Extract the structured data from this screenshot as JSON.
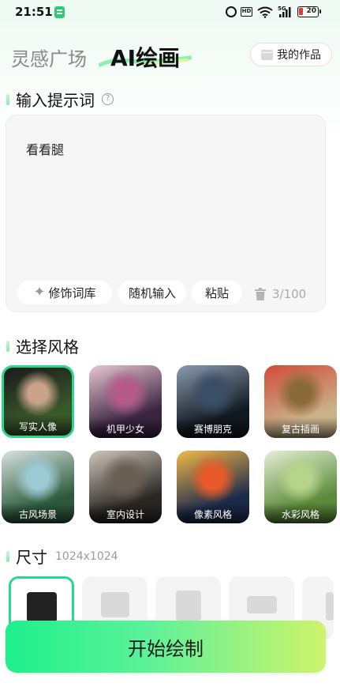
{
  "status_bar": {
    "time": "21:51",
    "hd": "HD",
    "signal": "5G",
    "battery": "20"
  },
  "header": {
    "tabs": [
      {
        "label": "灵感广场",
        "active": false
      },
      {
        "label": "AI绘画",
        "active": true
      }
    ],
    "works_button": "我的作品"
  },
  "prompt": {
    "title": "输入提示词",
    "help": "?",
    "text": "看看腿",
    "chips": [
      "修饰词库",
      "随机输入",
      "粘贴"
    ],
    "counter": "3/100"
  },
  "styles": {
    "title": "选择风格",
    "items": [
      {
        "label": "写实人像",
        "selected": true,
        "colors": [
          "#3b5a2c",
          "#c9a48a",
          "#1a1a1a"
        ]
      },
      {
        "label": "机甲少女",
        "selected": false,
        "colors": [
          "#3a2440",
          "#b45b8a",
          "#e8c7d0"
        ]
      },
      {
        "label": "赛博朋克",
        "selected": false,
        "colors": [
          "#101820",
          "#3a4e66",
          "#8a9bb0"
        ]
      },
      {
        "label": "复古插画",
        "selected": false,
        "colors": [
          "#c9b38a",
          "#8a6a3a",
          "#d24a3a"
        ]
      },
      {
        "label": "古风场景",
        "selected": false,
        "colors": [
          "#2e5a3c",
          "#9ccbd6",
          "#d8e4e0"
        ]
      },
      {
        "label": "室内设计",
        "selected": false,
        "colors": [
          "#2a2622",
          "#6a5f55",
          "#cfc6bb"
        ]
      },
      {
        "label": "像素风格",
        "selected": false,
        "colors": [
          "#1c2a4a",
          "#e85a2a",
          "#f2b94a"
        ]
      },
      {
        "label": "水彩风格",
        "selected": false,
        "colors": [
          "#5a8a3a",
          "#b6d48a",
          "#e6efd6"
        ]
      }
    ]
  },
  "size": {
    "title": "尺寸",
    "value": "1024x1024",
    "selected_index": 0
  },
  "start_button": "开始绘制",
  "colors": {
    "accent": "#27d98a",
    "gradient_start": "#1ef08b",
    "gradient_end": "#cff36b"
  }
}
